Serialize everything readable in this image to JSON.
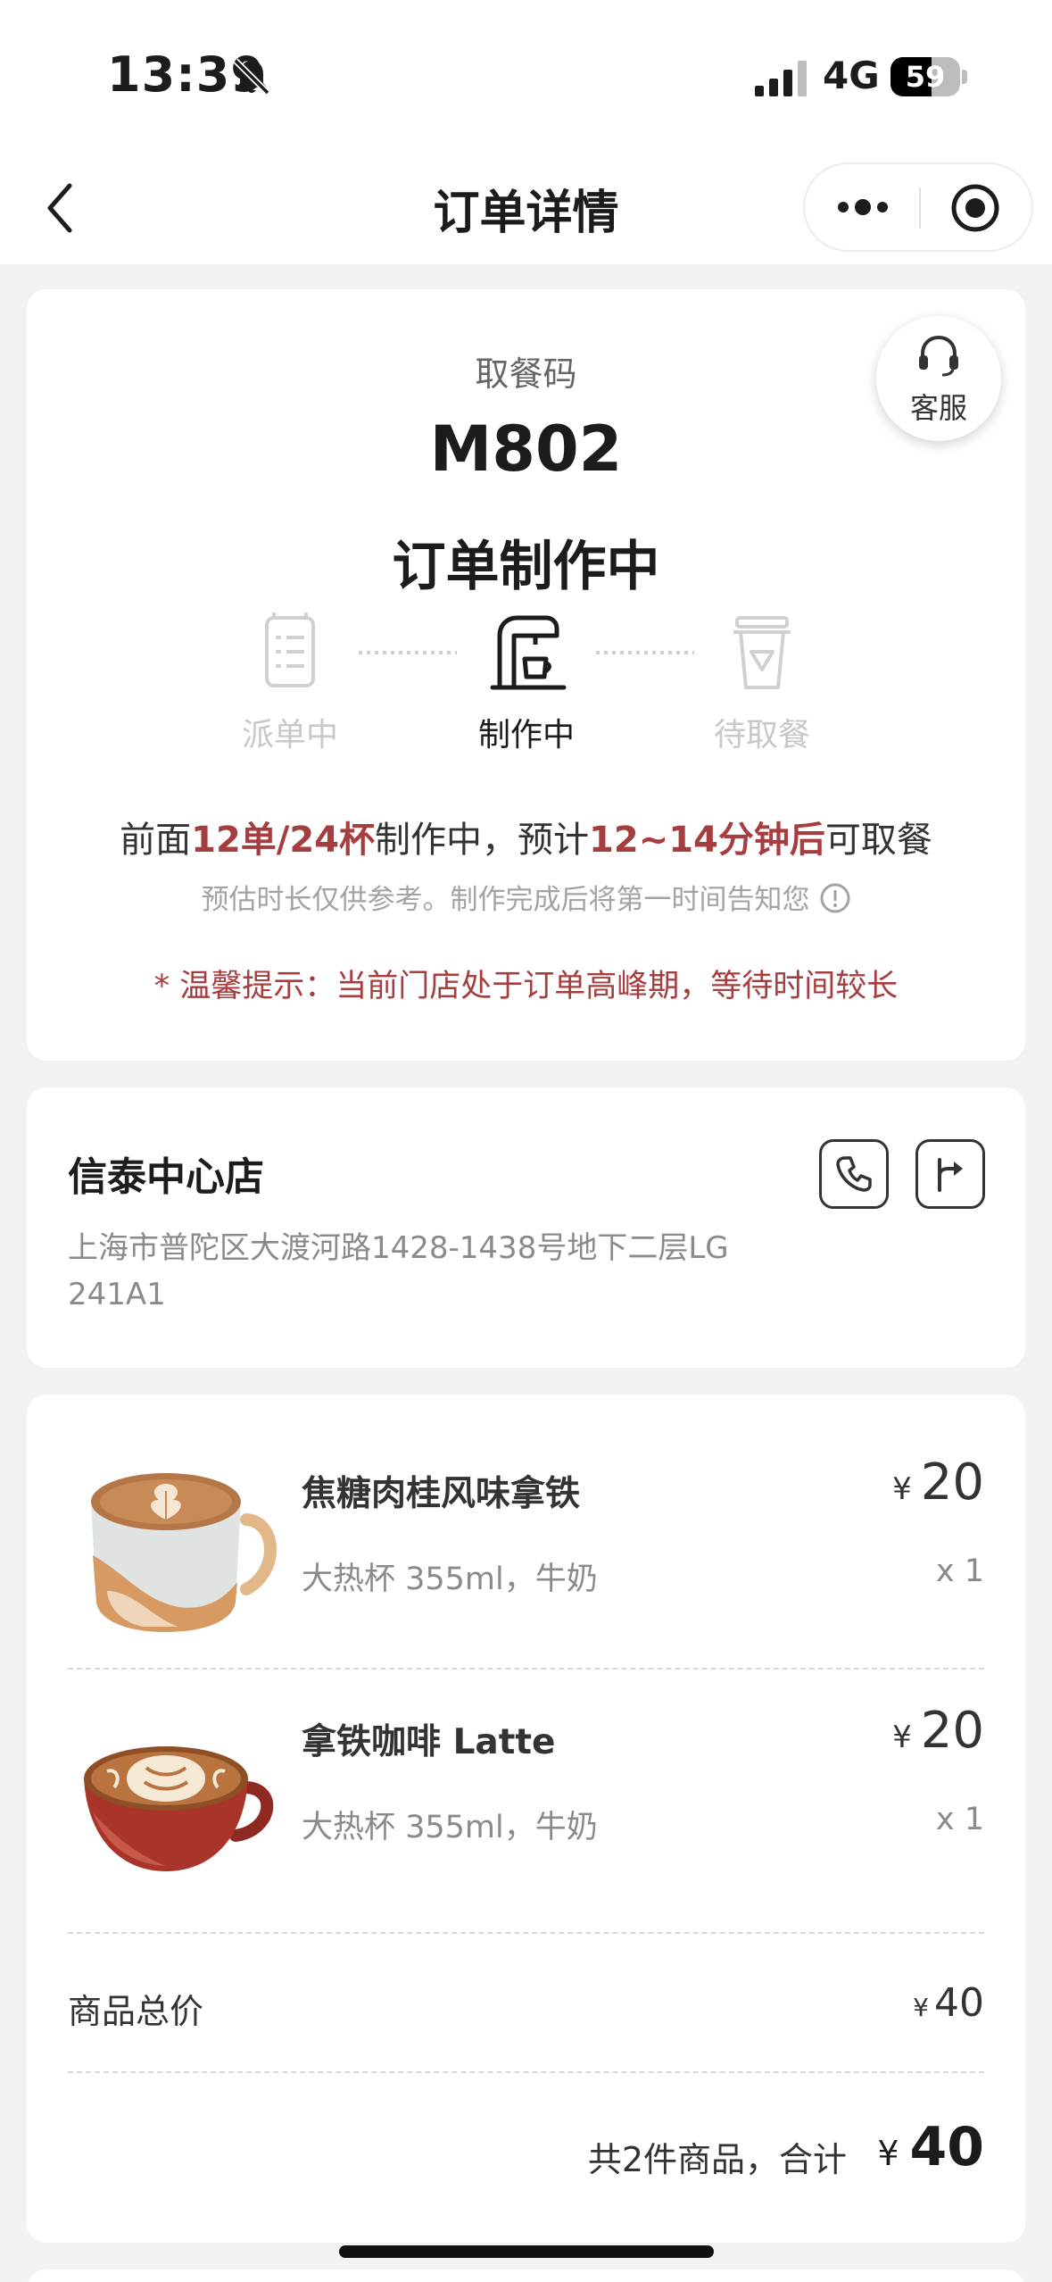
{
  "status_bar": {
    "time": "13:39",
    "network": "4G",
    "battery_level": "59",
    "battery_fraction": 0.59,
    "icons": [
      "bell-muted-icon",
      "signal-icon"
    ]
  },
  "nav": {
    "title": "订单详情",
    "back_icon": "chevron-left-icon",
    "more_icon": "more-dots-icon",
    "close_icon": "target-close-icon"
  },
  "order": {
    "service_label": "客服",
    "pickup_label": "取餐码",
    "pickup_code": "M802",
    "status_title": "订单制作中",
    "steps": [
      {
        "label": "派单中",
        "icon": "receipt-icon",
        "active": false
      },
      {
        "label": "制作中",
        "icon": "coffee-machine-icon",
        "active": true
      },
      {
        "label": "待取餐",
        "icon": "cup-icon",
        "active": false
      }
    ],
    "progress": {
      "prefix": "前面",
      "queue": "12单/24杯",
      "middle": "制作中，预计",
      "eta": "12~14分钟后",
      "suffix": "可取餐"
    },
    "estimate_note": "预估时长仅供参考。制作完成后将第一时间告知您",
    "warning": "* 温馨提示：当前门店处于订单高峰期，等待时间较长",
    "accent_color": "#a63d3f"
  },
  "store": {
    "name": "信泰中心店",
    "address": "上海市普陀区大渡河路1428-1438号地下二层LG 241A1",
    "call_icon": "phone-icon",
    "nav_icon": "directions-icon"
  },
  "items": [
    {
      "name": "焦糖肉桂风味拿铁",
      "spec": "大热杯 355ml，牛奶",
      "currency": "¥",
      "price": "20",
      "qty": "x 1",
      "image": "latte-mug-image"
    },
    {
      "name": "拿铁咖啡 Latte",
      "spec": "大热杯 355ml，牛奶",
      "currency": "¥",
      "price": "20",
      "qty": "x 1",
      "image": "latte-cup-image"
    }
  ],
  "summary": {
    "subtotal_label": "商品总价",
    "subtotal_currency": "¥",
    "subtotal_value": "40",
    "total_label": "共2件商品，合计",
    "total_currency": "¥",
    "total_value": "40"
  }
}
